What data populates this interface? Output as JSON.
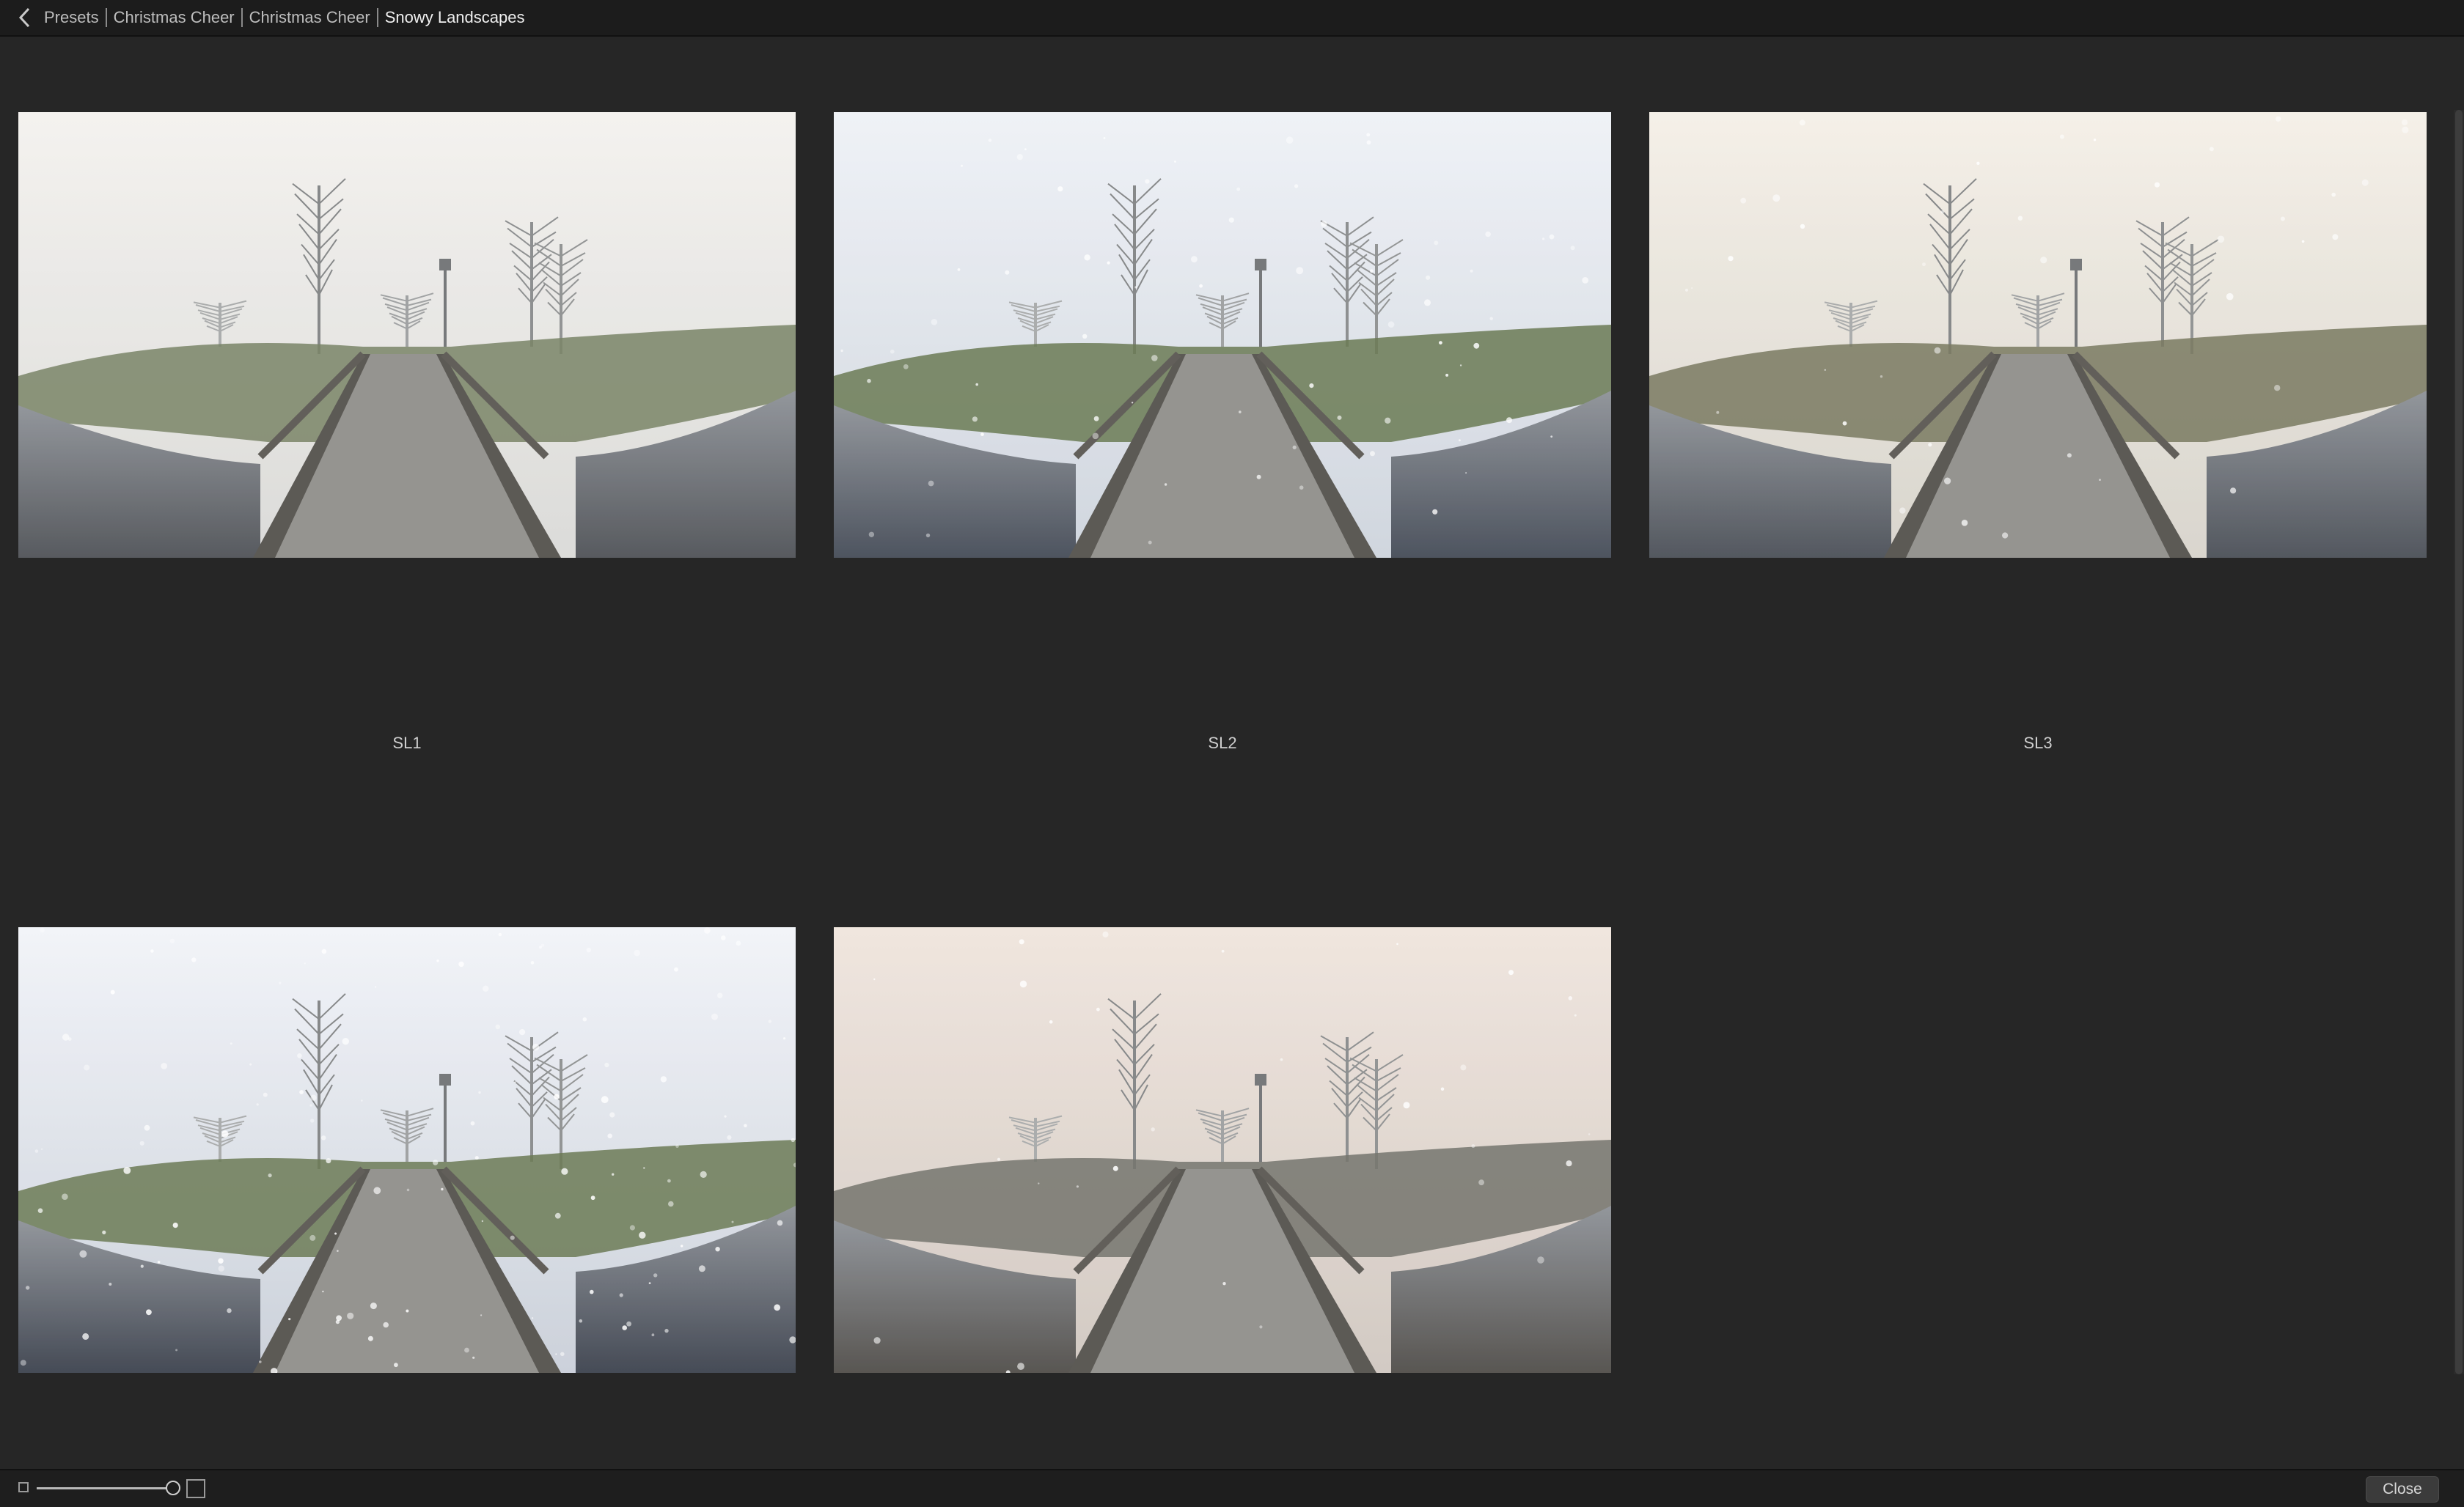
{
  "breadcrumb": {
    "items": [
      "Presets",
      "Christmas Cheer",
      "Christmas Cheer",
      "Snowy Landscapes"
    ]
  },
  "presets": [
    {
      "label": "SL1",
      "tone": "neutral"
    },
    {
      "label": "SL2",
      "tone": "cool-snow"
    },
    {
      "label": "SL3",
      "tone": "warm-haze"
    },
    {
      "label": "",
      "tone": "cool-heavy-snow"
    },
    {
      "label": "",
      "tone": "sepia"
    }
  ],
  "footer": {
    "close_label": "Close",
    "thumbnail_size_fraction": 1.0
  },
  "colors": {
    "background": "#262626",
    "bar": "#1c1c1c",
    "text": "#cfcfcf"
  }
}
